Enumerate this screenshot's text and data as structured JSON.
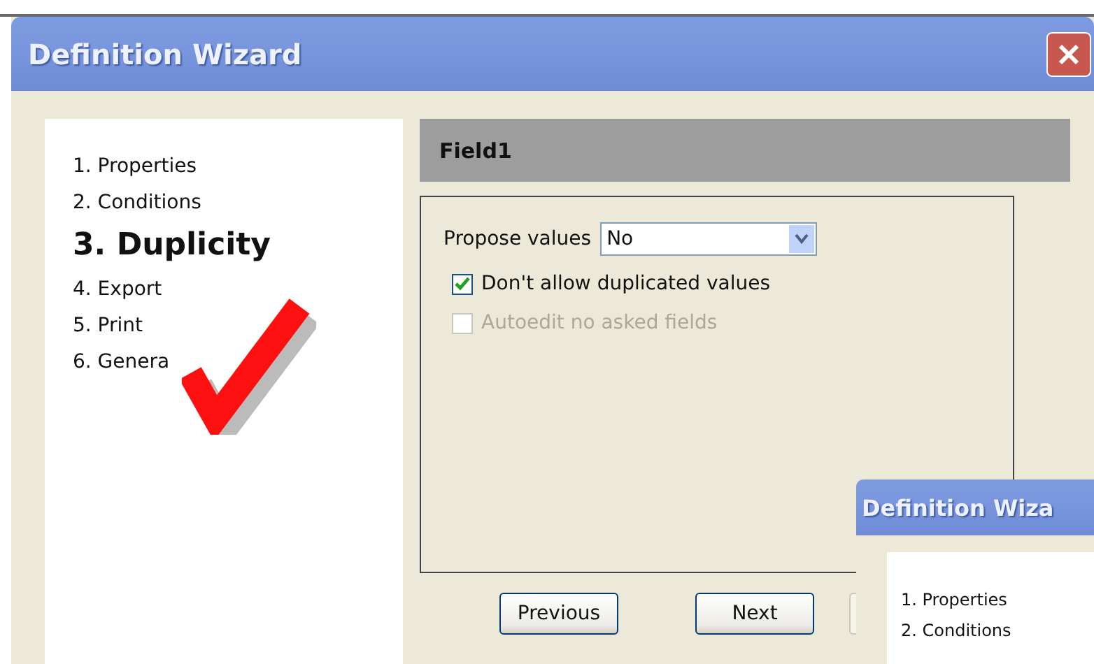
{
  "window": {
    "title": "Definition Wizard"
  },
  "steps": [
    {
      "label": "1. Properties",
      "selected": false
    },
    {
      "label": "2. Conditions",
      "selected": false
    },
    {
      "label": "3. Duplicity",
      "selected": true
    },
    {
      "label": "4. Export",
      "selected": false
    },
    {
      "label": "5. Print",
      "selected": false
    },
    {
      "label": "6. Genera",
      "selected": false
    }
  ],
  "header": "Field1",
  "propose": {
    "label": "Propose values",
    "value": "No"
  },
  "options": [
    {
      "label": "Don't allow duplicated values",
      "checked": true,
      "disabled": false
    },
    {
      "label": "Autoedit no asked fields",
      "checked": false,
      "disabled": true
    }
  ],
  "buttons": [
    {
      "label": "Previous",
      "disabled": false
    },
    {
      "label": "Next",
      "disabled": false
    },
    {
      "disabled": true
    }
  ],
  "second_window": {
    "title": "Definition Wiza",
    "steps": [
      {
        "label": "1. Properties",
        "selected": false
      },
      {
        "label": "2. Conditions",
        "selected": false
      }
    ]
  }
}
